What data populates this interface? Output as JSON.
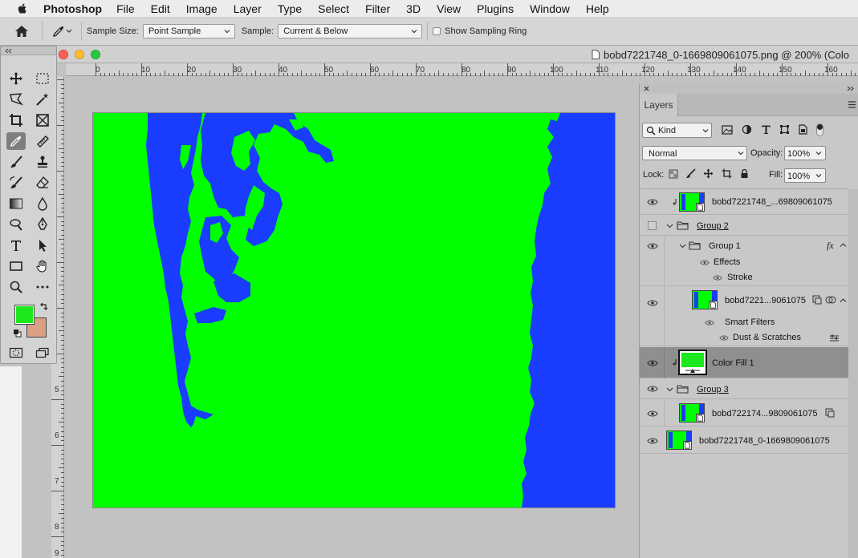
{
  "menubar": {
    "app": "Photoshop",
    "items": [
      "File",
      "Edit",
      "Image",
      "Layer",
      "Type",
      "Select",
      "Filter",
      "3D",
      "View",
      "Plugins",
      "Window",
      "Help"
    ]
  },
  "options": {
    "sample_size_label": "Sample Size:",
    "sample_size_value": "Point Sample",
    "sample_label": "Sample:",
    "sample_value": "Current & Below",
    "show_ring_label": "Show Sampling Ring"
  },
  "document": {
    "title": "bobd7221748_0-1669809061075.png @ 200% (Colo"
  },
  "rulers": {
    "h": [
      "0",
      "10",
      "20",
      "30",
      "40",
      "50",
      "60",
      "70",
      "80",
      "90",
      "100",
      "110",
      "120",
      "130",
      "140",
      "150",
      "160"
    ],
    "v": [
      "5",
      "6",
      "7",
      "8",
      "9"
    ]
  },
  "colors": {
    "foreground": "#1de81d",
    "background": "#d9a181",
    "canvas_green": "#00ff00",
    "canvas_blue": "#1a3cff"
  },
  "layers_panel": {
    "tab": "Layers",
    "filter_kind": "Kind",
    "blend_mode": "Normal",
    "opacity_label": "Opacity:",
    "opacity_value": "100%",
    "lock_label": "Lock:",
    "fill_label": "Fill:",
    "fill_value": "100%",
    "fx_label": "fx",
    "rows": [
      {
        "name": "bobd7221748_...69809061075"
      },
      {
        "name": "Group 2"
      },
      {
        "name": "Group 1"
      },
      {
        "name": "Effects"
      },
      {
        "name": "Stroke"
      },
      {
        "name": "bobd7221...9061075"
      },
      {
        "name": "Smart Filters"
      },
      {
        "name": "Dust & Scratches"
      },
      {
        "name": "Color Fill 1"
      },
      {
        "name": "Group 3"
      },
      {
        "name": "bobd722174...9809061075"
      },
      {
        "name": "bobd7221748_0-1669809061075"
      }
    ]
  }
}
